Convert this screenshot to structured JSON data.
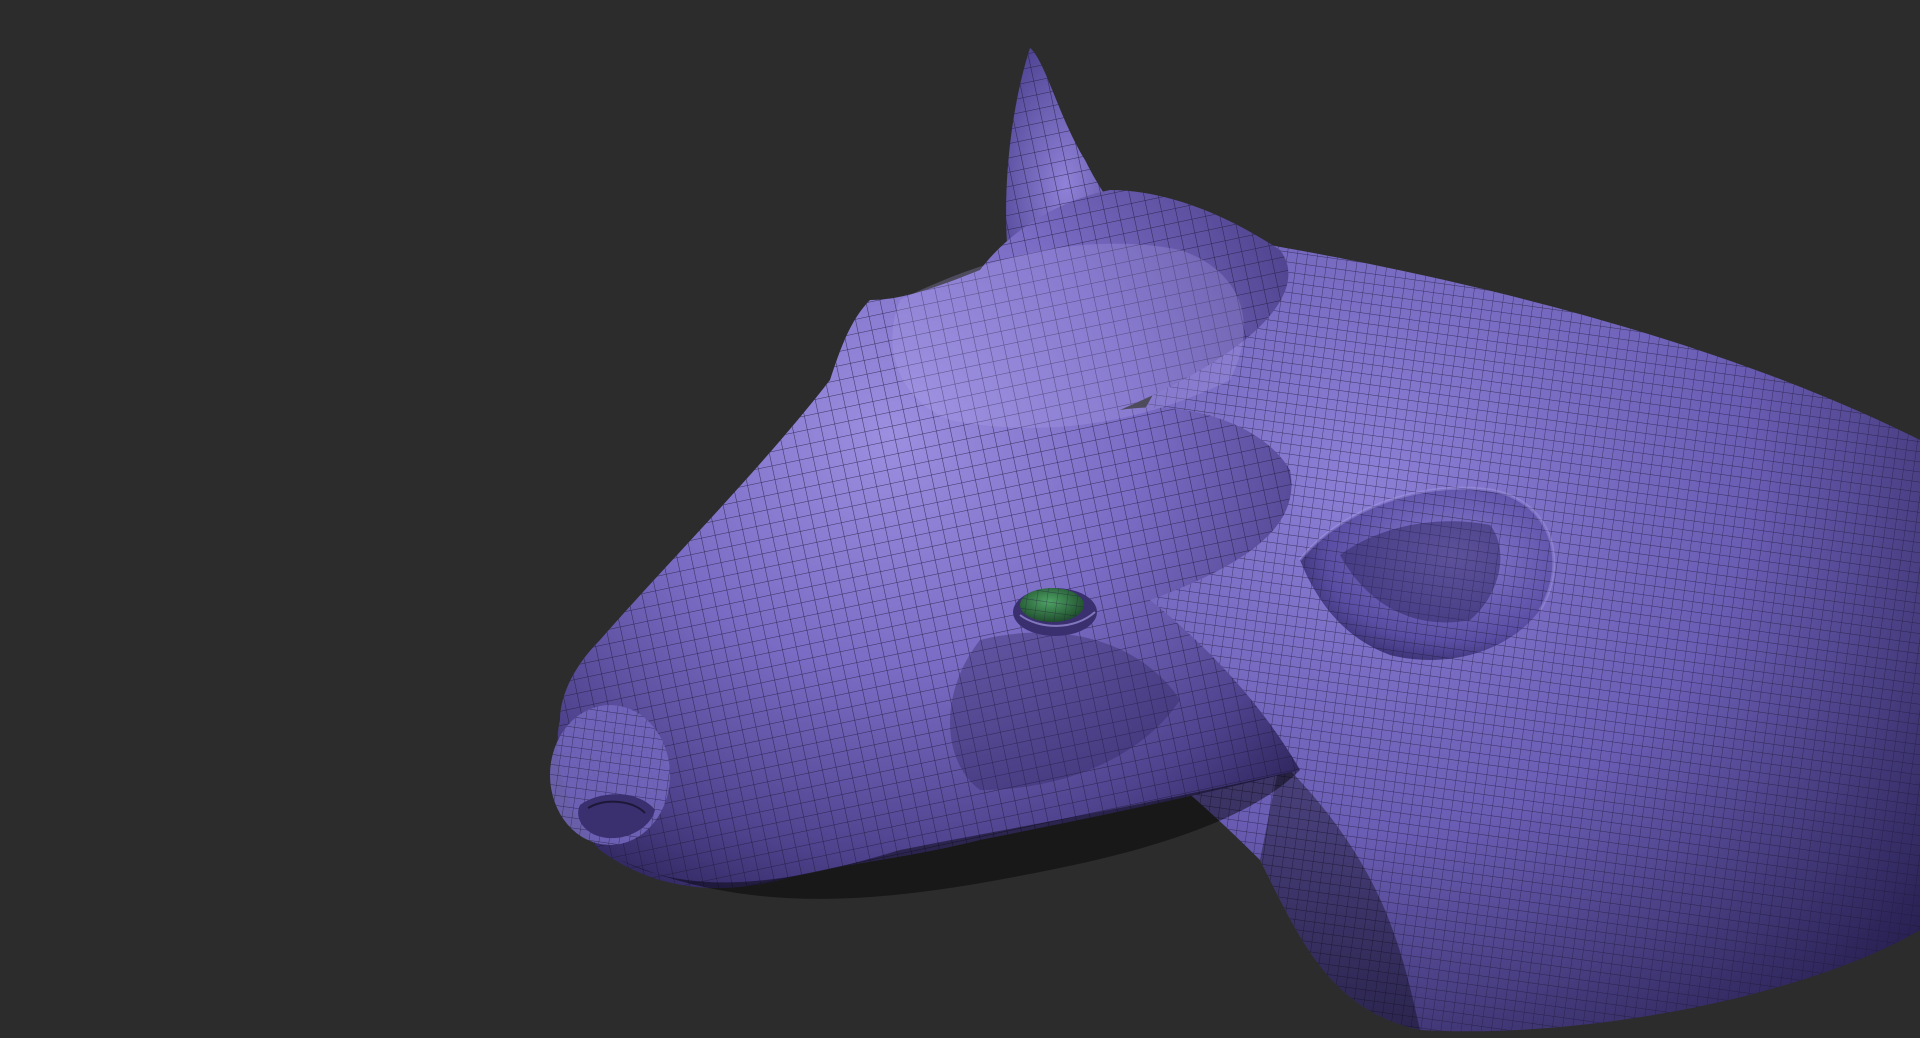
{
  "canvas": {
    "background_color": "#2c2c2c",
    "model_base_color": "#6f62b8",
    "model_highlight_color": "#9c8fe0",
    "model_shadow_color": "#2b2358",
    "wireframe_color": "#1e1838",
    "eye_color": "#3d8a52"
  },
  "model": {
    "subject": "cow-head-sculpt",
    "display_mode": "polyframe-wireframe"
  }
}
